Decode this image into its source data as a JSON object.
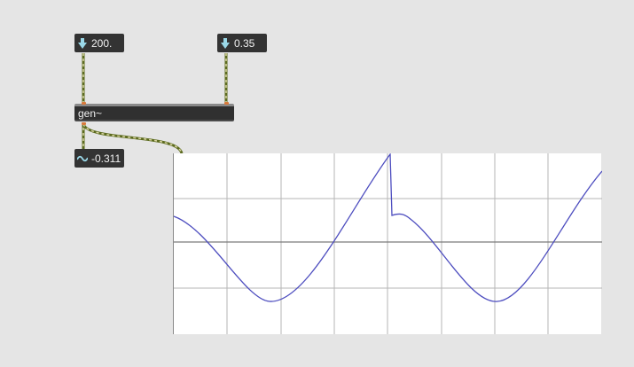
{
  "patch": {
    "number_box_1": {
      "value": "200.",
      "icon": "down-arrow-icon"
    },
    "number_box_2": {
      "value": "0.35",
      "icon": "down-arrow-icon"
    },
    "gen_object": {
      "label": "gen~"
    },
    "signal_number_box": {
      "value": "-0.311",
      "icon": "sine-wave-icon"
    }
  },
  "colors": {
    "canvas_background": "#e5e5e5",
    "object_box": "#333333",
    "object_text": "#f2f2f2",
    "patch_cord": "#5c6b1f",
    "patch_cord_dash": "#d8d4a0",
    "number_arrow": "#9ad8e8",
    "scope_background": "#ffffff",
    "scope_grid": "#b5b5b5",
    "scope_trace": "#4d4dbf"
  }
}
